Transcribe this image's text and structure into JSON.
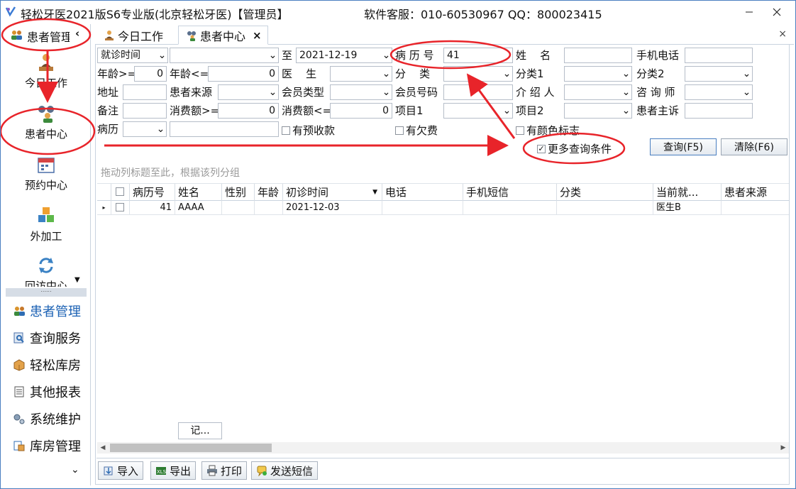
{
  "window": {
    "title": "轻松牙医2021版S6专业版(北京轻松牙医)【管理员】",
    "support": "软件客服：010-60530967 QQ：800023415",
    "minimize_icon": "minimize-icon",
    "close_icon": "close-icon"
  },
  "sidebar": {
    "header": "患者管理",
    "collapse_icon": "chevron-left-icon",
    "modules": [
      {
        "label": "今日工作",
        "icon": "person-desk-icon"
      },
      {
        "label": "患者中心",
        "icon": "binoculars-person-icon"
      },
      {
        "label": "预约中心",
        "icon": "calendar-icon"
      },
      {
        "label": "外加工",
        "icon": "cubes-icon"
      },
      {
        "label": "回访中心",
        "icon": "refresh-icon"
      }
    ],
    "groups": [
      {
        "label": "患者管理",
        "icon": "people-icon",
        "active": true
      },
      {
        "label": "查询服务",
        "icon": "search-doc-icon",
        "active": false
      },
      {
        "label": "轻松库房",
        "icon": "box-icon",
        "active": false
      },
      {
        "label": "其他报表",
        "icon": "report-icon",
        "active": false
      },
      {
        "label": "系统维护",
        "icon": "gears-icon",
        "active": false
      },
      {
        "label": "库房管理",
        "icon": "warehouse-icon",
        "active": false
      }
    ],
    "more_icon": "chevron-down-icon"
  },
  "tabs": [
    {
      "label": "今日工作",
      "icon": "person-desk-icon",
      "active": false
    },
    {
      "label": "患者中心",
      "icon": "binoculars-person-icon",
      "active": true,
      "close": "×"
    }
  ],
  "tabbar_close": "×",
  "filters": {
    "visit_time": {
      "label": "就诊时间",
      "from": "",
      "to_label": "至",
      "to": "2021-12-19"
    },
    "record_no": {
      "label": "病 历 号",
      "value": "41"
    },
    "name": {
      "label": "姓    名",
      "value": ""
    },
    "mobile": {
      "label": "手机电话",
      "value": ""
    },
    "age_min": {
      "label": "年龄>=",
      "value": "0"
    },
    "age_max": {
      "label": "年龄<=",
      "value": "0"
    },
    "doctor": {
      "label": "医    生",
      "value": ""
    },
    "category": {
      "label": "分    类",
      "value": ""
    },
    "category1": {
      "label": "分类1",
      "value": ""
    },
    "category2": {
      "label": "分类2",
      "value": ""
    },
    "address": {
      "label": "地址",
      "value": ""
    },
    "patient_source": {
      "label": "患者来源",
      "value": ""
    },
    "member_type": {
      "label": "会员类型",
      "value": ""
    },
    "member_no": {
      "label": "会员号码",
      "value": ""
    },
    "referrer": {
      "label": "介 绍 人",
      "value": ""
    },
    "consultant": {
      "label": "咨 询 师",
      "value": ""
    },
    "remark": {
      "label": "备注",
      "value": ""
    },
    "spend_min": {
      "label": "消费额>=",
      "value": "0"
    },
    "spend_max": {
      "label": "消费额<=",
      "value": "0"
    },
    "item1": {
      "label": "项目1",
      "value": ""
    },
    "item2": {
      "label": "项目2",
      "value": ""
    },
    "complaint": {
      "label": "患者主诉",
      "value": ""
    },
    "history": {
      "label": "病历",
      "value": "",
      "text": ""
    },
    "prepay": {
      "label": "有预收款",
      "checked": false
    },
    "debt": {
      "label": "有欠费",
      "checked": false
    },
    "color_mark": {
      "label": "有颜色标志",
      "checked": false
    },
    "more_conditions": {
      "label": "更多查询条件",
      "checked": true
    }
  },
  "buttons": {
    "query": "查询(F5)",
    "clear": "清除(F6)"
  },
  "grid": {
    "group_hint": "拖动列标题至此，根据该列分组",
    "columns": [
      "病历号",
      "姓名",
      "性别",
      "年龄",
      "初诊时间",
      "电话",
      "手机短信",
      "分类",
      "当前就...",
      "患者来源"
    ],
    "sorted_column": "初诊时间",
    "rows": [
      {
        "record_no": "41",
        "name": "AAAA",
        "gender": "",
        "age": "",
        "first_visit": "2021-12-03",
        "phone": "",
        "sms": "",
        "category": "",
        "current": "医生B",
        "source": ""
      }
    ],
    "footer": "记..."
  },
  "bottom_buttons": [
    {
      "label": "导入",
      "icon": "import-icon"
    },
    {
      "label": "导出",
      "icon": "export-icon"
    },
    {
      "label": "打印",
      "icon": "printer-icon"
    },
    {
      "label": "发送短信",
      "icon": "sms-icon"
    }
  ],
  "colors": {
    "accent": "#1c62b4",
    "annotation": "#e8242a"
  }
}
